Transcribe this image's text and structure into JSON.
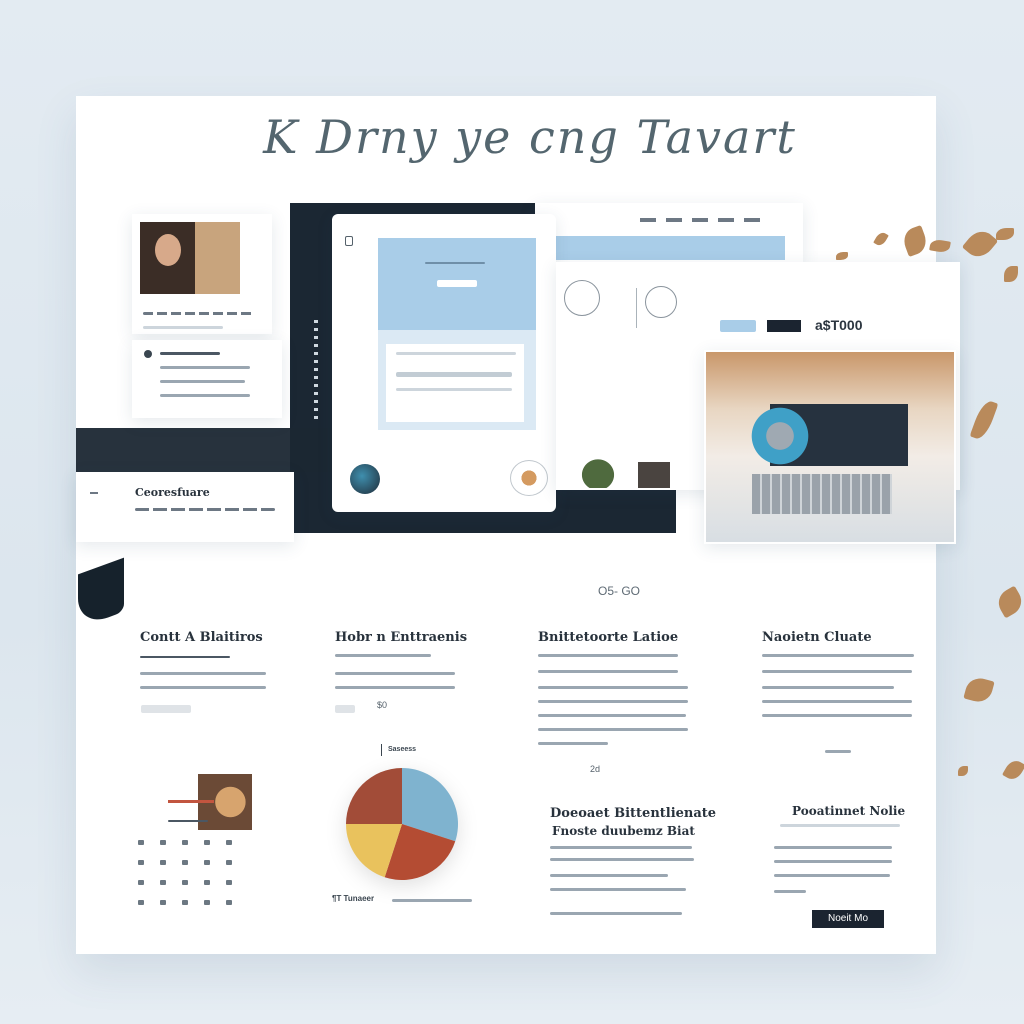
{
  "page": {
    "title": "K Drny ye  cng  Tavart",
    "price_tag": "a$T000",
    "center_caption": "O5- GO"
  },
  "left_card": {
    "footer_heading": "Ceoresfuare"
  },
  "columns": [
    {
      "heading": "Contt A Blaitiros"
    },
    {
      "heading": "Hobr n Enttraenis",
      "small_value": "$0"
    },
    {
      "heading": "Bnittetoorte Latioe",
      "small_value": "2d"
    },
    {
      "heading": "Naoietn Cluate"
    }
  ],
  "lower": {
    "pie_legend_label": "Saseess",
    "pie_caption": "¶T Tunaeer",
    "mid_card_title": "Doeoaet Bittentlienate",
    "mid_card_subtitle": "Fnoste duubemz  Biat",
    "right_card_title": "Pooatinnet Nolie",
    "cta_label": "Noeit Mo"
  },
  "chart_data": {
    "type": "pie",
    "values": [
      30,
      25,
      20,
      25
    ],
    "colors": [
      "#7fb3cf",
      "#b44c33",
      "#e9c25d",
      "#a24c38"
    ],
    "title": ""
  },
  "colors": {
    "accent_blue": "#a9cde8",
    "dark_panel": "#1b2733",
    "leaf": "#b98a5b"
  }
}
